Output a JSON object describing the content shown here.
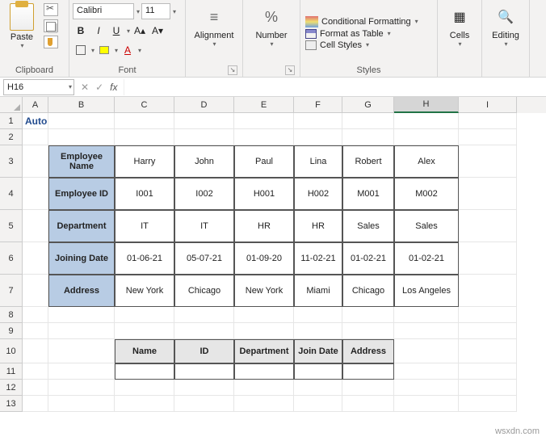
{
  "ribbon": {
    "clipboard": {
      "paste": "Paste",
      "label": "Clipboard"
    },
    "font": {
      "name": "Calibri",
      "size": "11",
      "bold": "B",
      "italic": "I",
      "underline": "U",
      "font_a": "A",
      "border": "",
      "fill": "",
      "color": "A",
      "label": "Font"
    },
    "alignment": {
      "btn": "Alignment"
    },
    "number": {
      "btn": "Number"
    },
    "styles": {
      "conditional": "Conditional Formatting",
      "table": "Format as Table",
      "cellstyles": "Cell Styles",
      "label": "Styles"
    },
    "cells": {
      "btn": "Cells"
    },
    "editing": {
      "btn": "Editing"
    }
  },
  "namebox": "H16",
  "cols": [
    "A",
    "B",
    "C",
    "D",
    "E",
    "F",
    "G",
    "H",
    "I"
  ],
  "rows_head": [
    "1",
    "2",
    "3",
    "4",
    "5",
    "6",
    "7",
    "8",
    "9",
    "10",
    "11",
    "12",
    "13"
  ],
  "title": "Auto Populate Cells In Excel Based On Another Cell",
  "table1": {
    "headers": [
      "Employee Name",
      "Employee ID",
      "Department",
      "Joining Date",
      "Address"
    ],
    "cols": [
      "Harry",
      "John",
      "Paul",
      "Lina",
      "Robert",
      "Alex"
    ],
    "rows": {
      "emp_id": [
        "I001",
        "I002",
        "H001",
        "H002",
        "M001",
        "M002"
      ],
      "department": [
        "IT",
        "IT",
        "HR",
        "HR",
        "Sales",
        "Sales"
      ],
      "joining": [
        "01-06-21",
        "05-07-21",
        "01-09-20",
        "11-02-21",
        "01-02-21",
        "01-02-21"
      ],
      "address": [
        "New York",
        "Chicago",
        "New York",
        "Miami",
        "Chicago",
        "Los Angeles"
      ]
    }
  },
  "table2": {
    "headers": [
      "Name",
      "ID",
      "Department",
      "Join Date",
      "Address"
    ]
  },
  "watermark": "wsxdn.com",
  "fb": {
    "cancel": "✕",
    "enter": "✓",
    "fx": "fx"
  }
}
